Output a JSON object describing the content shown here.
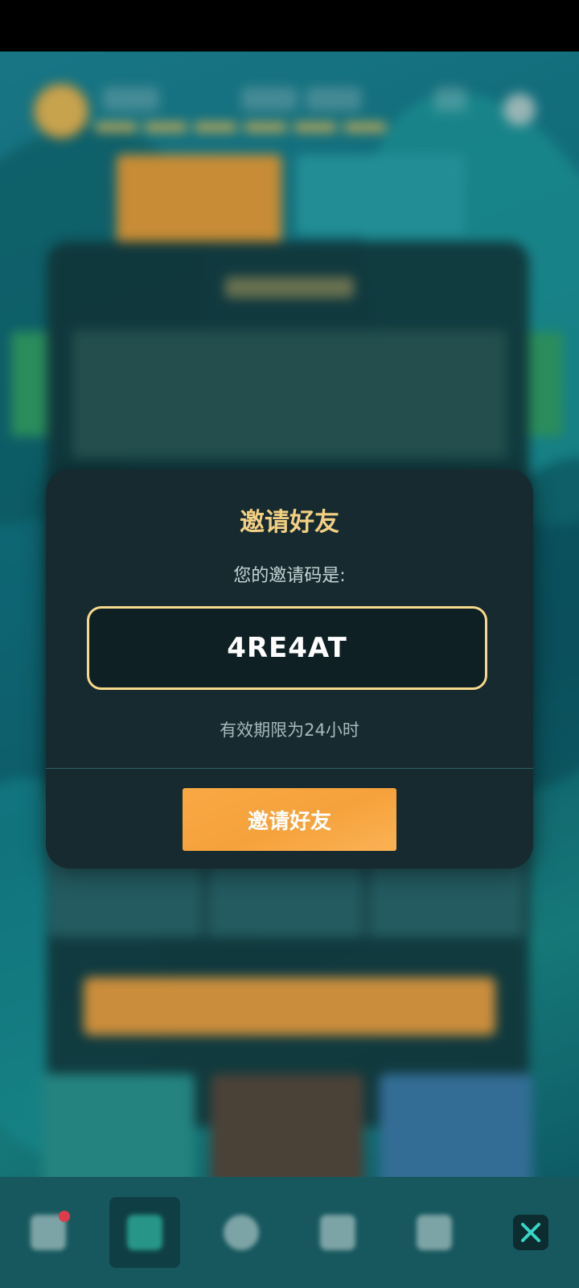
{
  "dialog": {
    "title": "邀请好友",
    "code_label": "您的邀请码是:",
    "invite_code": "4RE4AT",
    "validity_text": "有效期限为24小时",
    "invite_button": "邀请好友"
  },
  "bottom_nav": {
    "items": [
      {
        "icon": "pyramid-icon",
        "badge": true
      },
      {
        "icon": "shield-icon",
        "active": true
      },
      {
        "icon": "compass-icon"
      },
      {
        "icon": "diamond-icon"
      },
      {
        "icon": "heart-icon"
      },
      {
        "icon": "close-icon"
      }
    ]
  },
  "colors": {
    "dialog_bg": "#162a2f",
    "title_gold": "#f2cf82",
    "code_border": "#f6d98c",
    "button_orange": "#f6a23c"
  }
}
